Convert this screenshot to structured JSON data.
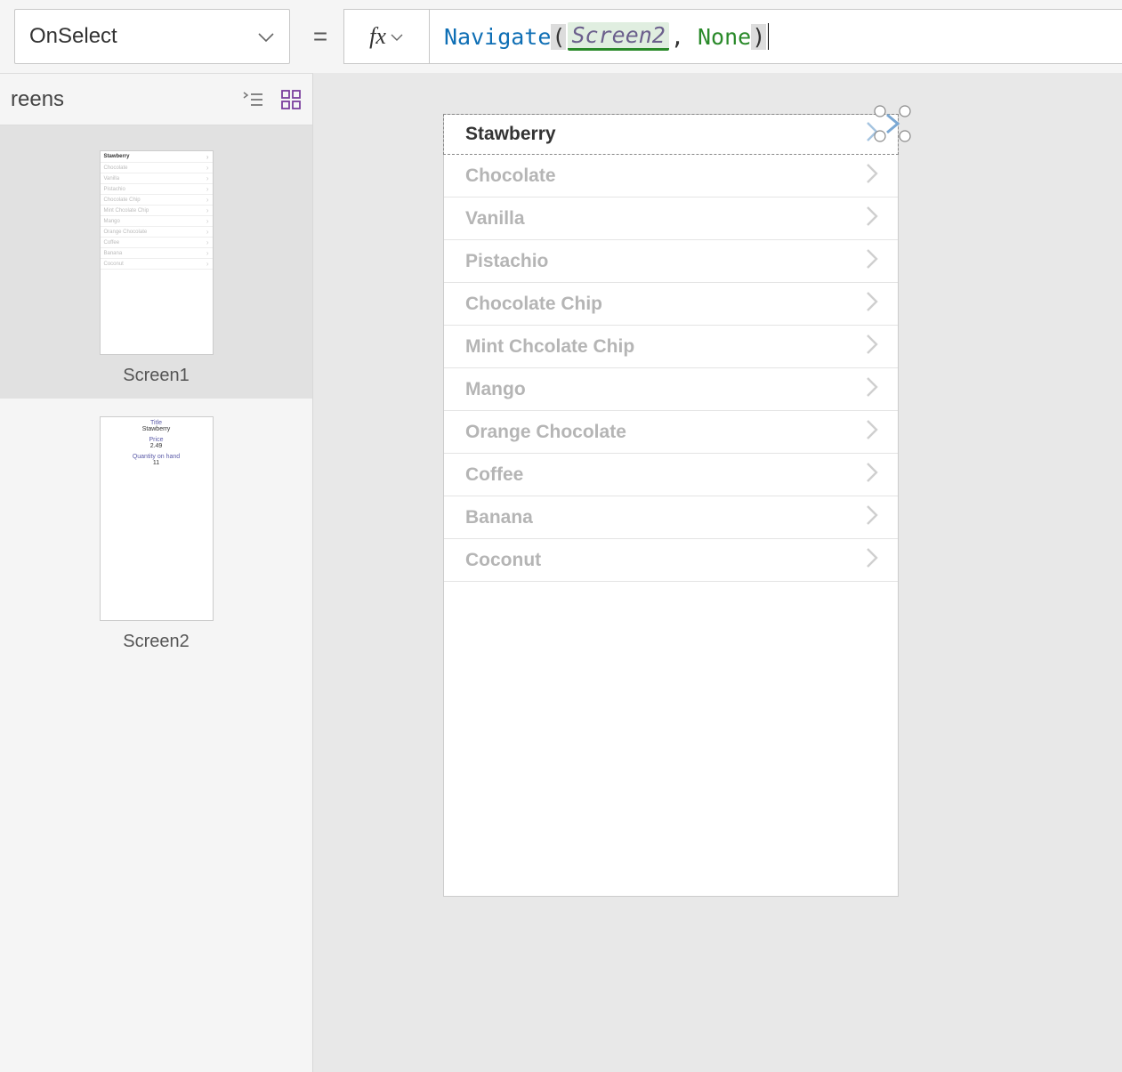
{
  "topbar": {
    "property": "OnSelect",
    "equals": "=",
    "fx": "fx",
    "formula": {
      "func": "Navigate",
      "open": "(",
      "arg1": "Screen2",
      "comma": ",",
      "space": " ",
      "arg2": "None",
      "close": ")"
    }
  },
  "panel": {
    "title": "reens",
    "screens": [
      {
        "label": "Screen1"
      },
      {
        "label": "Screen2"
      }
    ]
  },
  "thumb1_rows": [
    "Stawberry",
    "Chocolate",
    "Vanilla",
    "Pistachio",
    "Chocolate Chip",
    "Mint Chcolate Chip",
    "Mango",
    "Orange Chocolate",
    "Coffee",
    "Banana",
    "Coconut"
  ],
  "thumb2_fields": {
    "f1": "Title",
    "v1": "Stawberry",
    "f2": "Price",
    "v2": "2.49",
    "f3": "Quantity on hand",
    "v3": "11"
  },
  "gallery": {
    "items": [
      "Stawberry",
      "Chocolate",
      "Vanilla",
      "Pistachio",
      "Chocolate Chip",
      "Mint Chcolate Chip",
      "Mango",
      "Orange Chocolate",
      "Coffee",
      "Banana",
      "Coconut"
    ]
  }
}
